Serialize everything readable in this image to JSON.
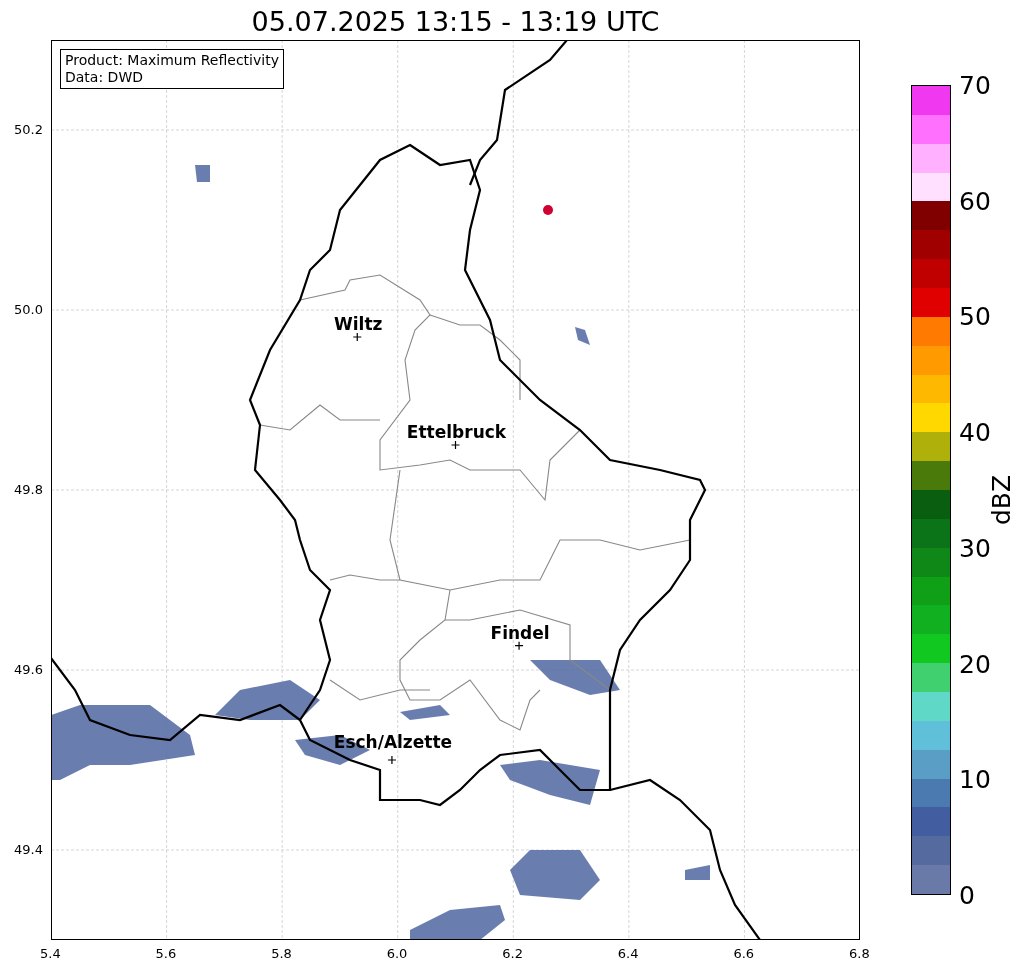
{
  "title": "05.07.2025 13:15 - 13:19 UTC",
  "info_box": [
    "Product: Maximum Reflectivity",
    "Data: DWD"
  ],
  "x_axis": {
    "ticks": [
      "5.4",
      "5.6",
      "5.8",
      "6.0",
      "6.2",
      "6.4",
      "6.6",
      "6.8"
    ]
  },
  "y_axis": {
    "ticks": [
      "50.2",
      "50.0",
      "49.8",
      "49.6",
      "49.4"
    ]
  },
  "cities": [
    {
      "name": "Wiltz"
    },
    {
      "name": "Ettelbruck"
    },
    {
      "name": "Findel"
    },
    {
      "name": "Esch/Alzette"
    }
  ],
  "colorbar": {
    "label": "dBZ",
    "ticks": [
      "70",
      "60",
      "50",
      "40",
      "30",
      "20",
      "10",
      "0"
    ],
    "bins": [
      {
        "color": "#6a7aa8"
      },
      {
        "color": "#556ba0"
      },
      {
        "color": "#425ea0"
      },
      {
        "color": "#4a7ab0"
      },
      {
        "color": "#5a9ec6"
      },
      {
        "color": "#60c0da"
      },
      {
        "color": "#60d8c8"
      },
      {
        "color": "#40d070"
      },
      {
        "color": "#10c820"
      },
      {
        "color": "#10b020"
      },
      {
        "color": "#10a018"
      },
      {
        "color": "#108818"
      },
      {
        "color": "#0c7418"
      },
      {
        "color": "#0a5e10"
      },
      {
        "color": "#4a7a0a"
      },
      {
        "color": "#b0b00a"
      },
      {
        "color": "#ffd800"
      },
      {
        "color": "#ffb800"
      },
      {
        "color": "#ff9a00"
      },
      {
        "color": "#ff7a00"
      },
      {
        "color": "#e00000"
      },
      {
        "color": "#c00000"
      },
      {
        "color": "#a00000"
      },
      {
        "color": "#800000"
      },
      {
        "color": "#ffe0ff"
      },
      {
        "color": "#ffb0ff"
      },
      {
        "color": "#ff70ff"
      },
      {
        "color": "#f038f0"
      }
    ]
  }
}
